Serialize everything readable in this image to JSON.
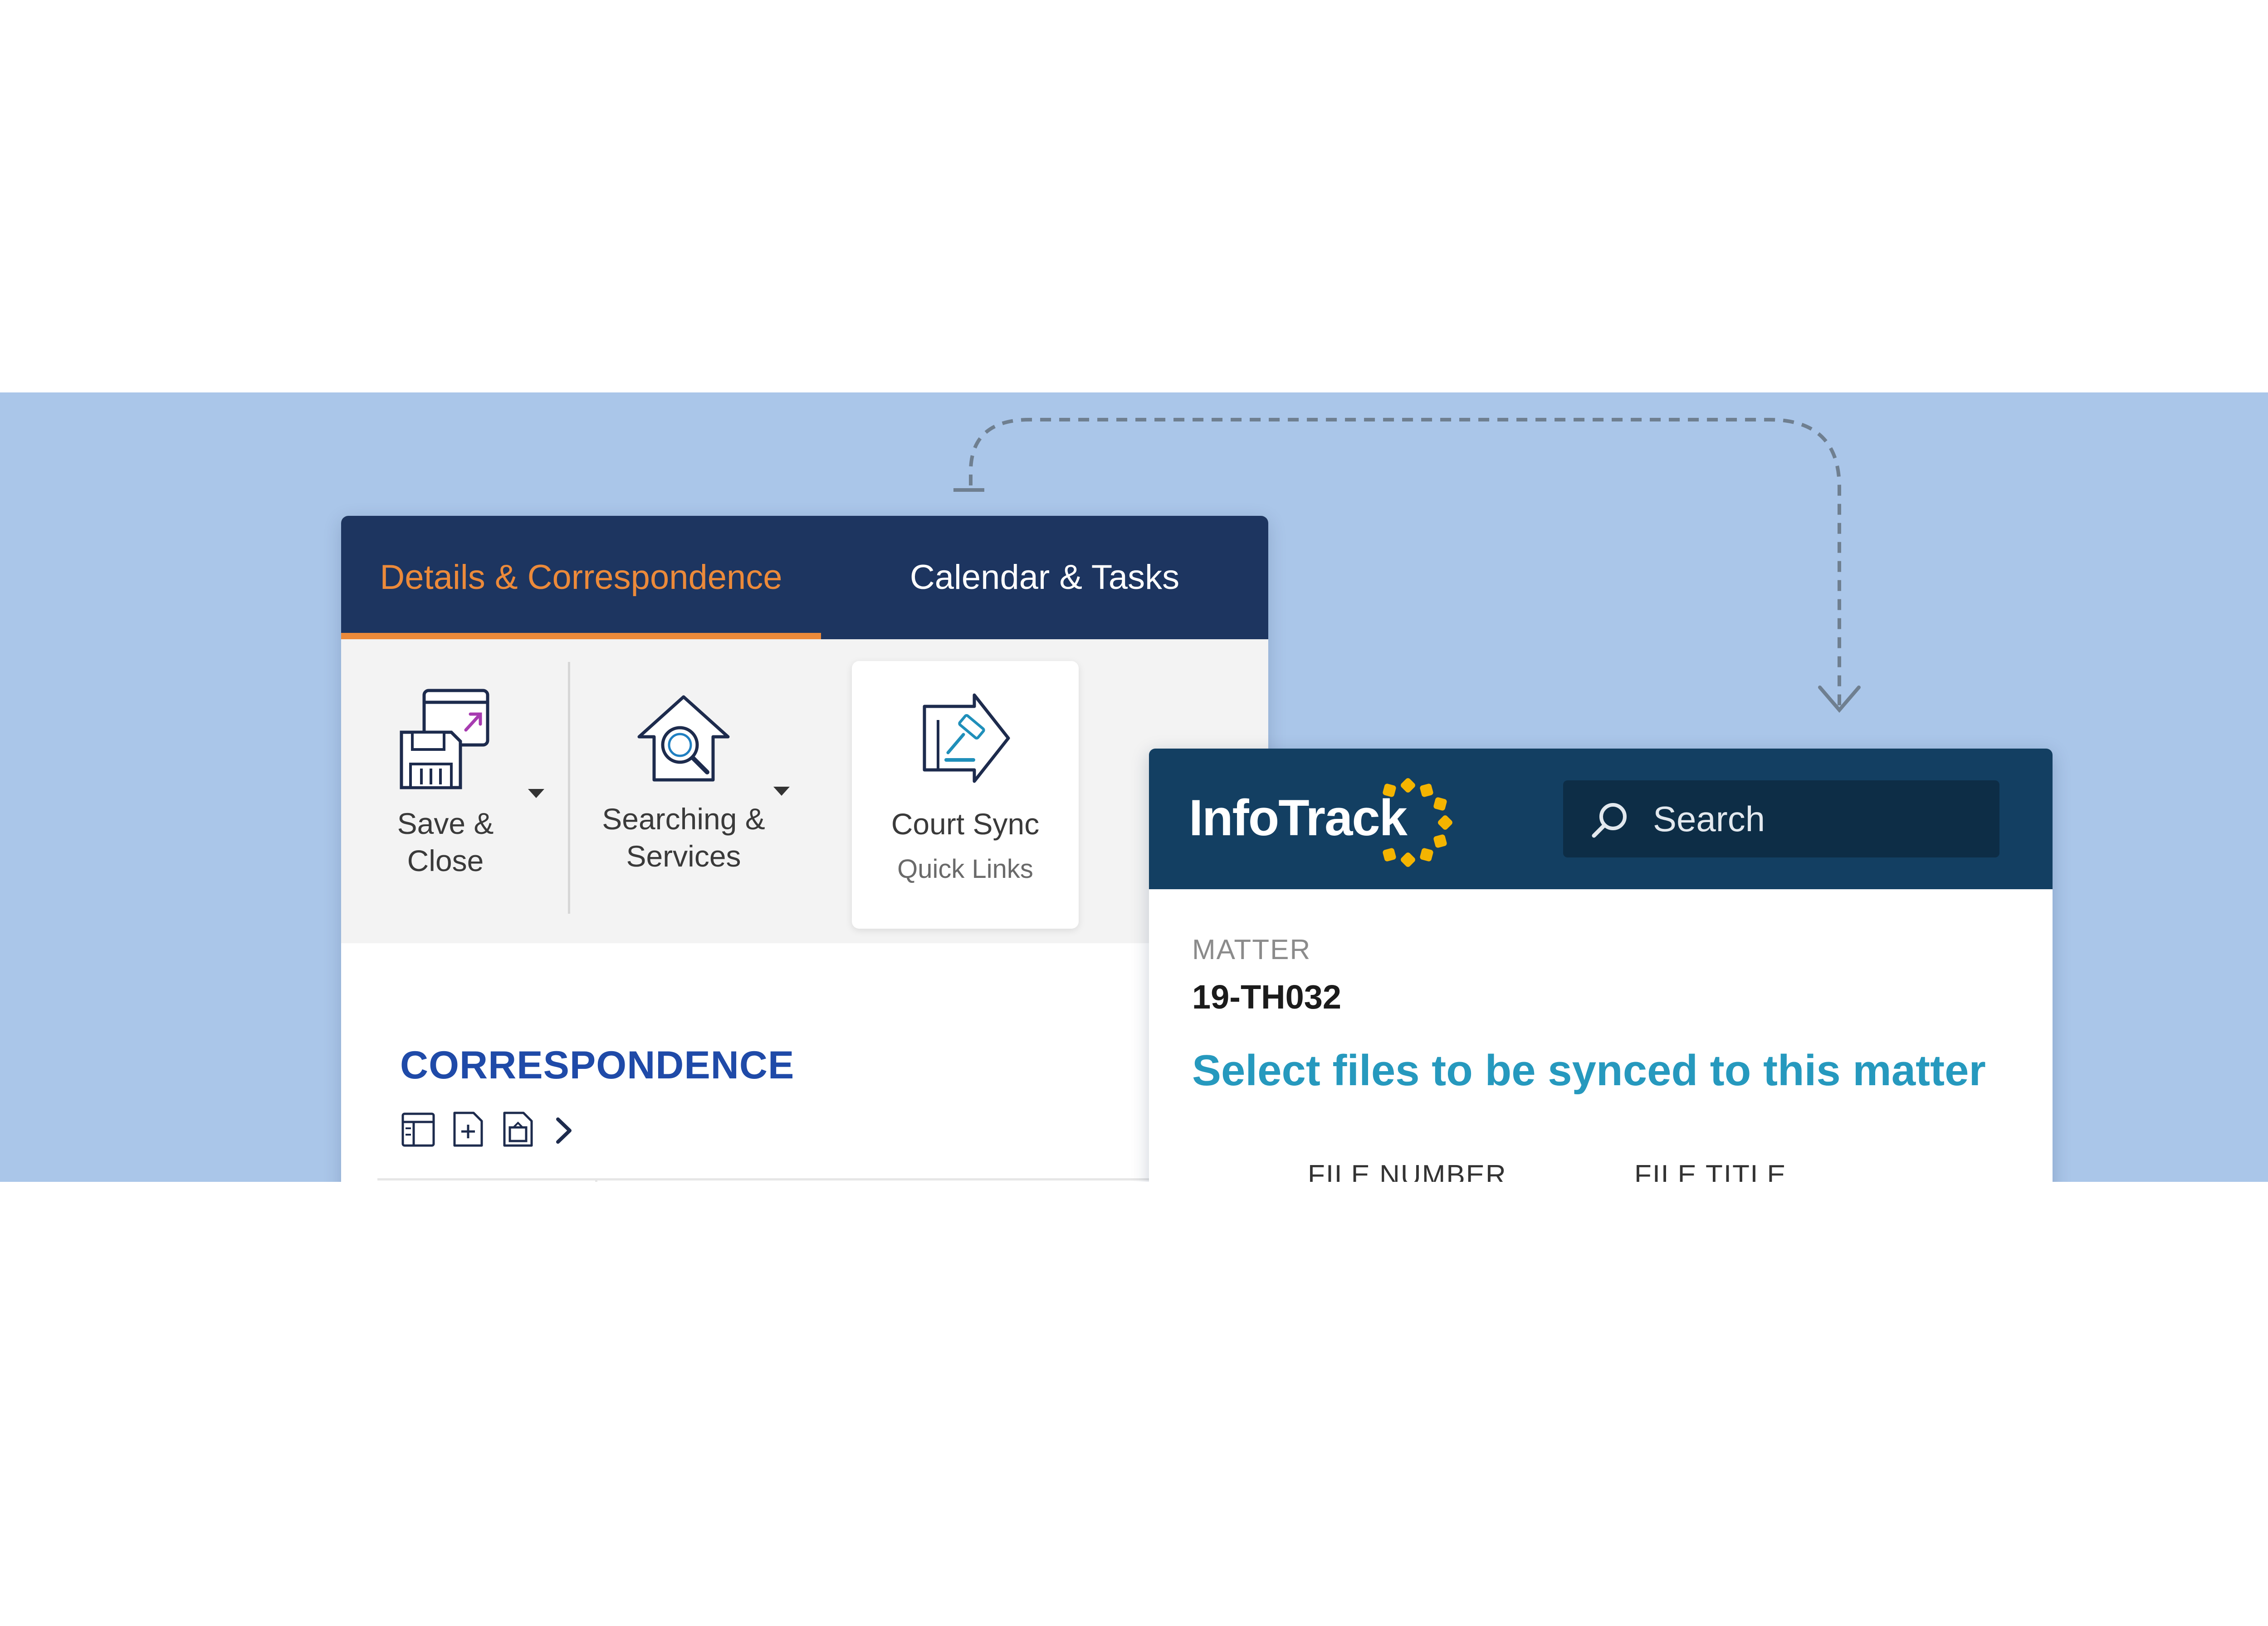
{
  "app": {
    "tabs": [
      {
        "label": "Details & Correspondence",
        "active": true
      },
      {
        "label": "Calendar & Tasks",
        "active": false
      }
    ],
    "ribbon": {
      "save": {
        "line1": "Save &",
        "line2": "Close"
      },
      "searching": {
        "line1": "Searching &",
        "line2": "Services"
      },
      "court_sync": {
        "label": "Court Sync",
        "sublabel": "Quick Links"
      }
    },
    "correspondence": {
      "title": "CORRESPONDENCE"
    }
  },
  "infotrack": {
    "logo": "InfoTrack",
    "search_placeholder": "Search",
    "matter_label": "MATTER",
    "matter_value": "19-TH032",
    "heading": "Select files to be synced to this matter",
    "columns": [
      "FILE NUMBER",
      "FILE TITLE"
    ]
  },
  "colors": {
    "band": "#aac6e9",
    "navy_tabbar": "#1d3560",
    "active_tab": "#ec8a3a",
    "infotrack_header": "#133f62",
    "search_box": "#0d2d46",
    "heading_teal": "#2699be",
    "correspondence_blue": "#1f4aa8",
    "logo_dots": "#f4b400"
  },
  "icons": [
    "save-close-icon",
    "searching-services-icon",
    "court-sync-icon",
    "panel-layout-icon",
    "add-document-icon",
    "export-document-icon",
    "chevron-right-icon",
    "search-icon"
  ]
}
